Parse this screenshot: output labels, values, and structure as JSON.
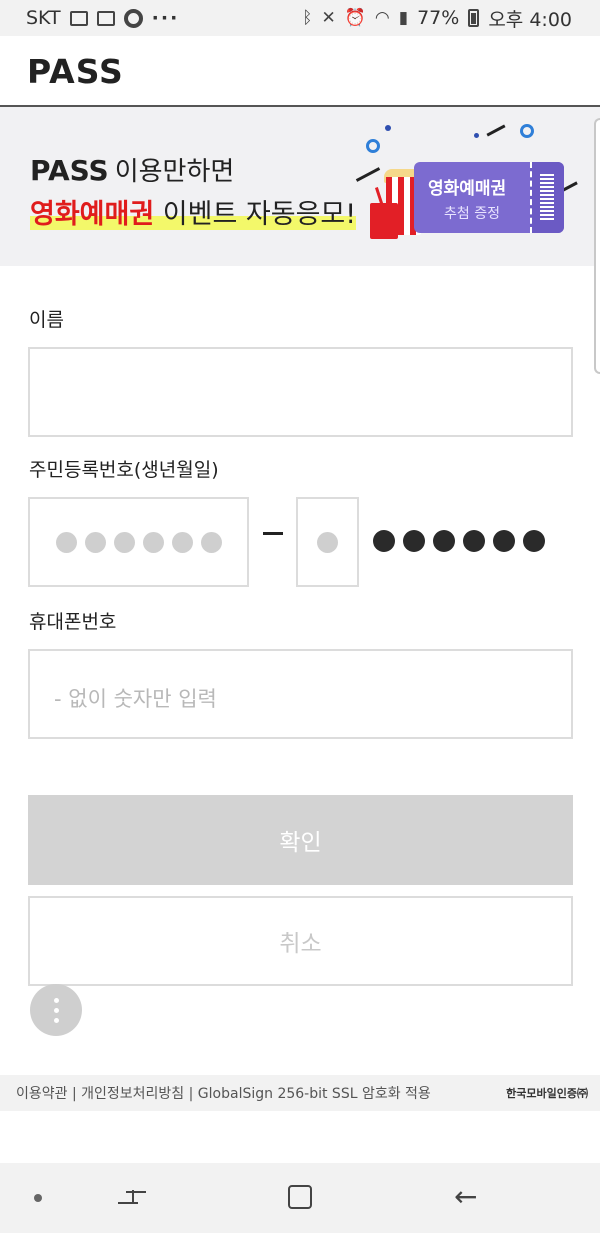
{
  "status_bar": {
    "carrier": "SKT",
    "more": "···",
    "battery_percent": "77%",
    "time": "오후 4:00"
  },
  "header": {
    "logo": "PASS"
  },
  "banner": {
    "logo": "PASS",
    "line1": "이용만하면",
    "line2_highlight": "영화예매권",
    "line2_rest": " 이벤트 자동응모!",
    "ticket_title": "영화예매권",
    "ticket_subtitle": "추첨 증정"
  },
  "form": {
    "name_label": "이름",
    "name_value": "",
    "rrn_label": "주민등록번호(생년월일)",
    "rrn_front_digits": 6,
    "rrn_back_first_digits": 1,
    "rrn_back_masked_digits": 6,
    "phone_label": "휴대폰번호",
    "phone_placeholder": "- 없이 숫자만 입력"
  },
  "buttons": {
    "confirm": "확인",
    "cancel": "취소"
  },
  "footer": {
    "links": "이용약관 | 개인정보처리방침 | GlobalSign 256-bit SSL 암호화 적용",
    "brand": "한국모바일인증㈜"
  },
  "colors": {
    "accent_purple": "#7c6bd0",
    "highlight_red": "#e01c1c",
    "disabled_gray": "#d3d3d3"
  }
}
